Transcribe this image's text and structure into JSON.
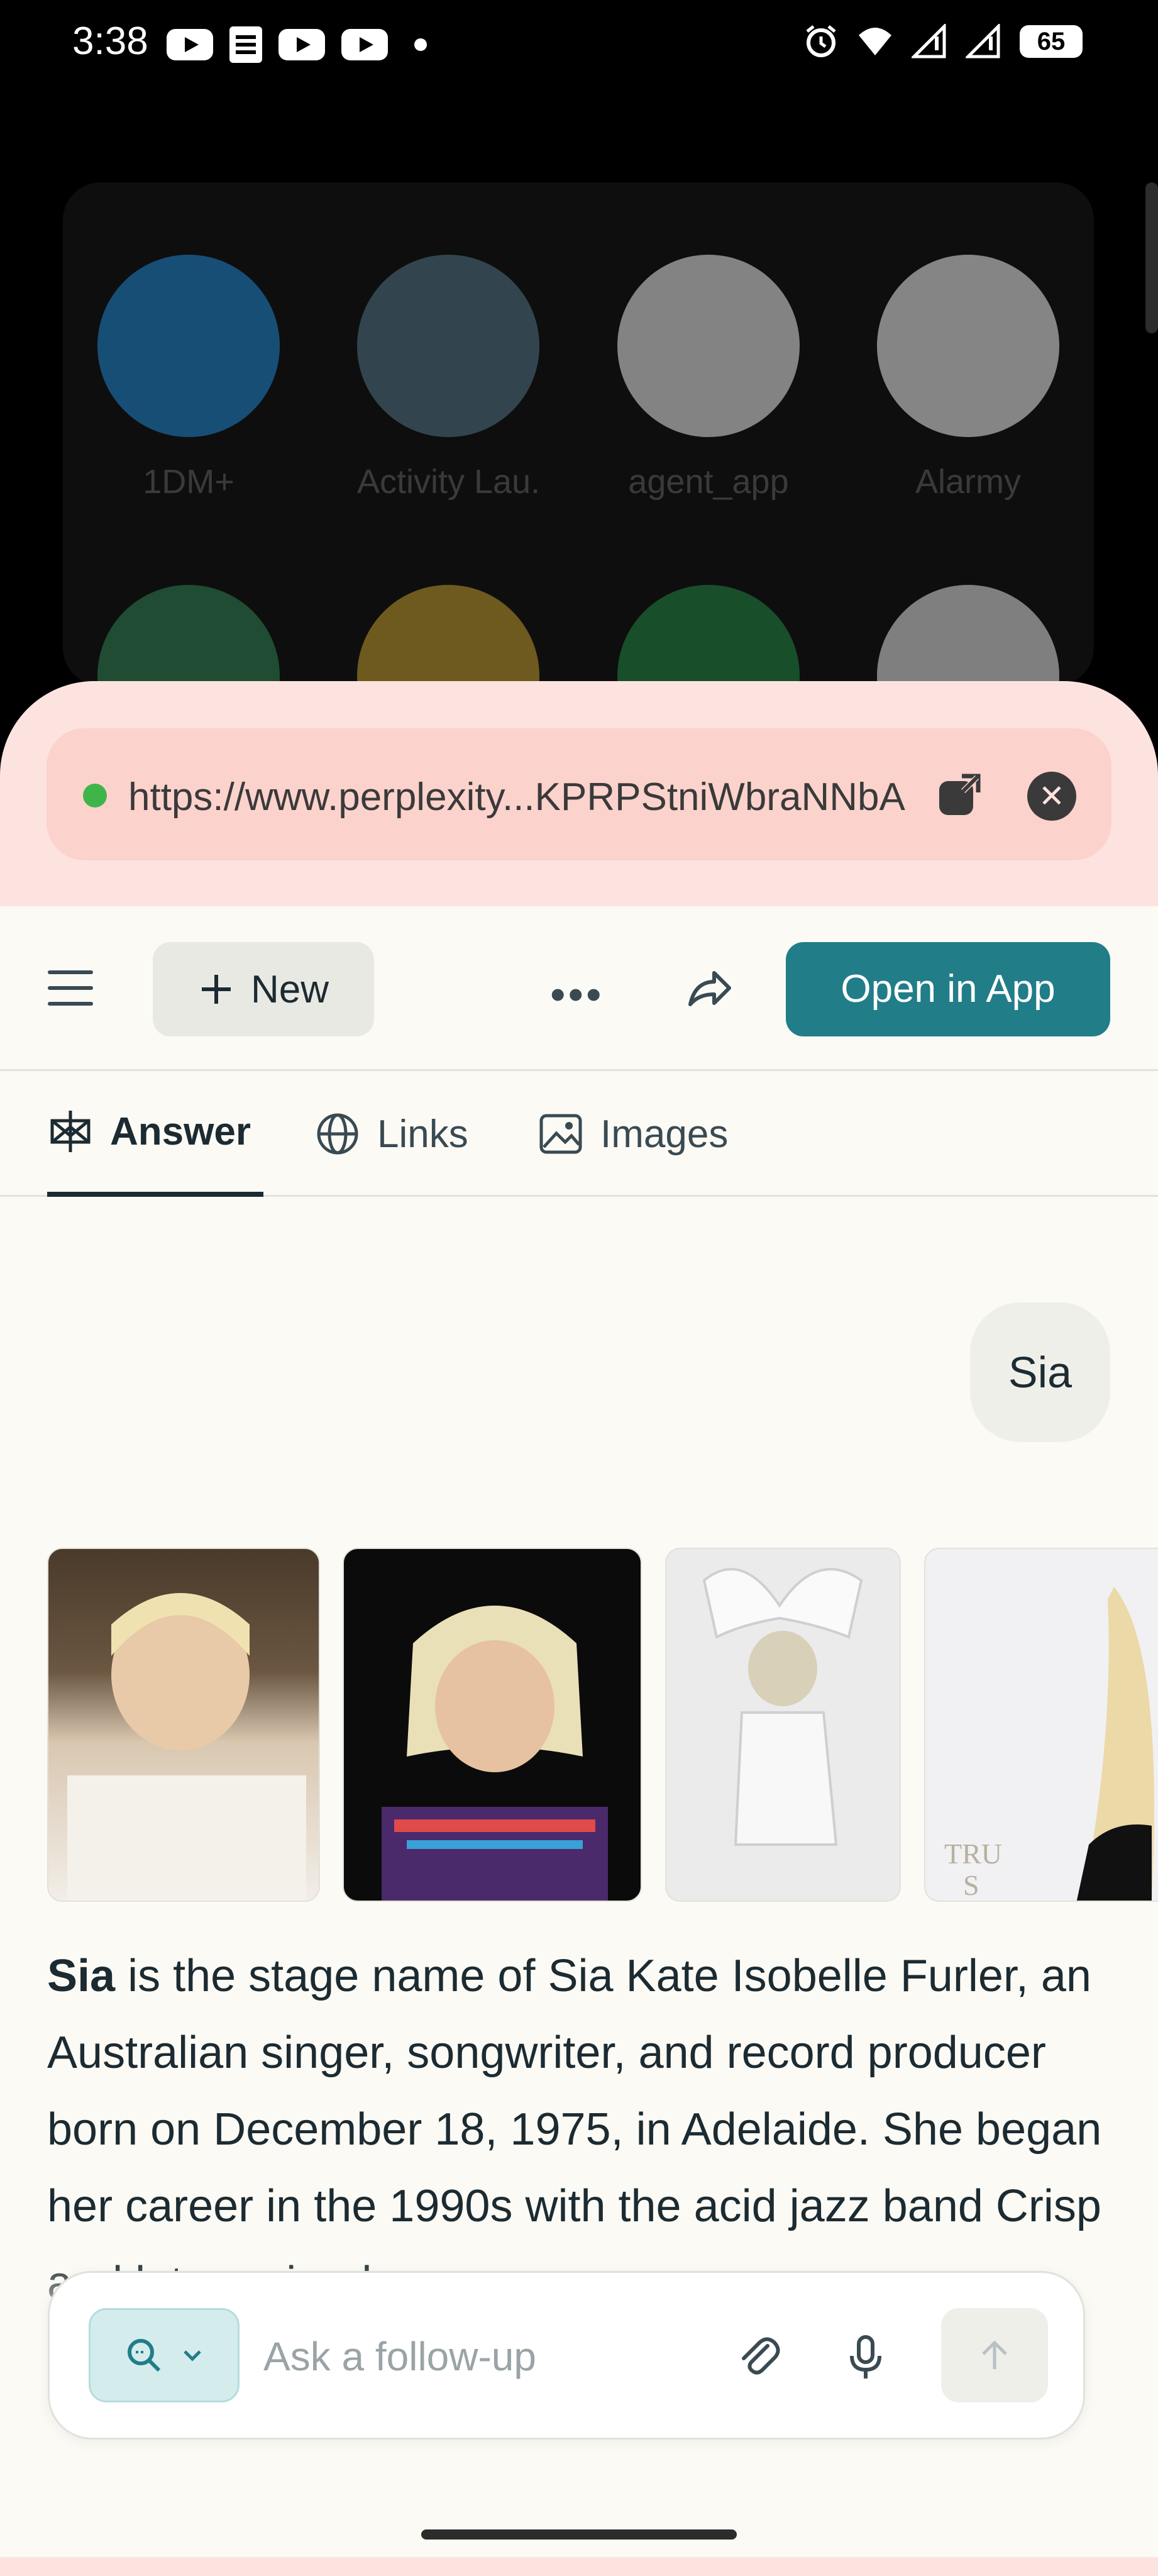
{
  "status_bar": {
    "time": "3:38",
    "battery": "65",
    "notification_icons": [
      "youtube-icon",
      "docs-icon",
      "youtube-icon",
      "youtube-icon",
      "dot-icon"
    ],
    "system_icons": [
      "alarm-icon",
      "wifi-icon",
      "signal-icon",
      "signal-icon",
      "battery-icon"
    ]
  },
  "launcher": {
    "apps": [
      {
        "label": "1DM+",
        "color": "#2a8fd8"
      },
      {
        "label": "Activity Lau...",
        "color": "#5b7f8e"
      },
      {
        "label": "agent_app",
        "color": "#eeeeee"
      },
      {
        "label": "Alarmy",
        "color": "#f2f2f2"
      }
    ]
  },
  "browser": {
    "url": "https://www.perplexity...KPRPStniWbraNNbA"
  },
  "toolbar": {
    "new_label": "New",
    "more_label": "•••",
    "open_in_app_label": "Open in App"
  },
  "tabs": [
    {
      "label": "Answer",
      "active": true
    },
    {
      "label": "Links",
      "active": false
    },
    {
      "label": "Images",
      "active": false
    }
  ],
  "query": "Sia",
  "answer": {
    "bold": "Sia",
    "text": " is the stage name of Sia Kate Isobelle Furler, an Australian singer, songwriter, and record producer born on December 18, 1975, in Adelaide. She began her career in the 1990s with the acid jazz band Crisp and later gained"
  },
  "composer": {
    "placeholder": "Ask a follow-up"
  },
  "colors": {
    "accent": "#217d88",
    "sheet_bg": "#fde3df",
    "page_bg": "#fbfaf5",
    "text": "#1c2b31"
  }
}
